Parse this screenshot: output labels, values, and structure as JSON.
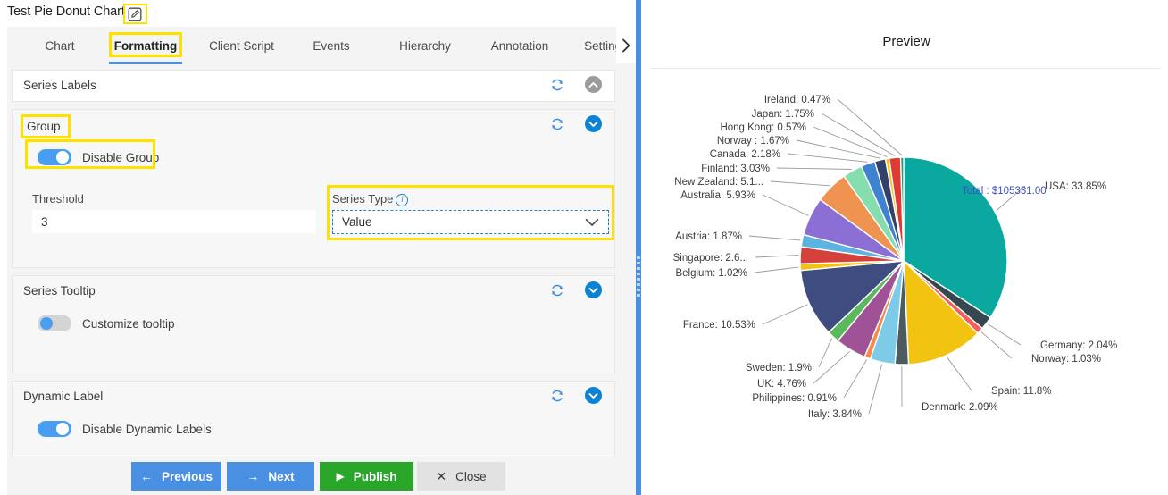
{
  "window": {
    "title": "Test Pie Donut Chart",
    "edit_icon": "pencil-square-icon",
    "help_icon": "?",
    "close_icon": "✕"
  },
  "tabs": {
    "items": [
      {
        "label": "Chart",
        "active": false
      },
      {
        "label": "Formatting",
        "active": true
      },
      {
        "label": "Client Script",
        "active": false
      },
      {
        "label": "Events",
        "active": false
      },
      {
        "label": "Hierarchy",
        "active": false
      },
      {
        "label": "Annotation",
        "active": false
      },
      {
        "label": "Settings",
        "active": false
      }
    ],
    "overflow_icon": "›"
  },
  "panels": {
    "series_labels": {
      "title": "Series Labels",
      "refresh_icon": "refresh-icon",
      "chevron": "chevron-up-icon"
    },
    "group": {
      "title": "Group",
      "refresh_icon": "refresh-icon",
      "chevron": "chevron-down-icon",
      "disable_group_label": "Disable Group",
      "disable_group_state": "on",
      "threshold_label": "Threshold",
      "threshold_value": "3",
      "series_type_label": "Series Type",
      "series_type_info": "i",
      "series_type_value": "Value"
    },
    "series_tooltip": {
      "title": "Series Tooltip",
      "refresh_icon": "refresh-icon",
      "chevron": "chevron-down-icon",
      "customize_tooltip_label": "Customize tooltip",
      "customize_tooltip_state": "off"
    },
    "dynamic_label": {
      "title": "Dynamic Label",
      "refresh_icon": "refresh-icon",
      "chevron": "chevron-down-icon",
      "disable_dynamic_labels_label": "Disable Dynamic Labels",
      "disable_dynamic_labels_state": "on"
    }
  },
  "footer": {
    "previous": "Previous",
    "previous_icon": "←",
    "next": "Next",
    "next_icon": "→",
    "publish": "Publish",
    "publish_icon": "▶",
    "close": "Close",
    "close_icon": "✕"
  },
  "preview": {
    "title": "Preview",
    "center_total_label": "Total : $105331.00"
  },
  "chart_data": {
    "type": "pie",
    "title": "Preview",
    "center_annotation": "Total : $105331.00",
    "total": 105331.0,
    "currency": "$",
    "label_format": "{name}: {percent}%",
    "legend": "none",
    "categories": [
      "USA",
      "Spain",
      "France",
      "Australia",
      "New Zealand",
      "UK",
      "Italy",
      "Finland",
      "Singapore",
      "Canada",
      "Denmark",
      "Germany",
      "Sweden",
      "Austria",
      "Japan",
      "Norway ",
      "Norway",
      "Belgium",
      "Philippines",
      "Hong Kong",
      "Ireland"
    ],
    "values": [
      33.85,
      11.8,
      10.53,
      5.93,
      5.1,
      4.76,
      3.84,
      3.03,
      2.6,
      2.18,
      2.09,
      2.04,
      1.9,
      1.87,
      1.75,
      1.67,
      1.03,
      1.02,
      0.91,
      0.57,
      0.47
    ],
    "unit": "%",
    "slices": [
      {
        "label": "USA: 33.85%",
        "name": "USA",
        "percent": 33.85,
        "color": "#0aa89e"
      },
      {
        "label": "Germany: 2.04%",
        "name": "Germany",
        "percent": 2.04,
        "color": "#37474f"
      },
      {
        "label": "Norway: 1.03%",
        "name": "Norway",
        "percent": 1.03,
        "color": "#f4605a"
      },
      {
        "label": "Spain: 11.8%",
        "name": "Spain",
        "percent": 11.8,
        "color": "#f2c311"
      },
      {
        "label": "Denmark: 2.09%",
        "name": "Denmark",
        "percent": 2.09,
        "color": "#4c5b60"
      },
      {
        "label": "Italy: 3.84%",
        "name": "Italy",
        "percent": 3.84,
        "color": "#7ecbe8"
      },
      {
        "label": "Philippines: 0.91%",
        "name": "Philippines",
        "percent": 0.91,
        "color": "#f58a4b"
      },
      {
        "label": "UK: 4.76%",
        "name": "UK",
        "percent": 4.76,
        "color": "#a05296"
      },
      {
        "label": "Sweden: 1.9%",
        "name": "Sweden",
        "percent": 1.9,
        "color": "#5cb85c"
      },
      {
        "label": "France: 10.53%",
        "name": "France",
        "percent": 10.53,
        "color": "#3e4c80"
      },
      {
        "label": "Belgium: 1.02%",
        "name": "Belgium",
        "percent": 1.02,
        "color": "#f2c311"
      },
      {
        "label": "Singapore: 2.6...",
        "name": "Singapore",
        "percent": 2.6,
        "color": "#d6403a"
      },
      {
        "label": "Austria: 1.87%",
        "name": "Austria",
        "percent": 1.87,
        "color": "#5cb3e0"
      },
      {
        "label": "Australia: 5.93%",
        "name": "Australia",
        "percent": 5.93,
        "color": "#8b6fd4"
      },
      {
        "label": "New Zealand: 5.1...",
        "name": "New Zealand",
        "percent": 5.1,
        "color": "#ef9350"
      },
      {
        "label": "Finland: 3.03%",
        "name": "Finland",
        "percent": 3.03,
        "color": "#86ddae"
      },
      {
        "label": "Canada: 2.18%",
        "name": "Canada",
        "percent": 2.18,
        "color": "#3f82d0"
      },
      {
        "label": "Norway : 1.67%",
        "name": "Norway ",
        "percent": 1.67,
        "color": "#33406b"
      },
      {
        "label": "Hong Kong: 0.57%",
        "name": "Hong Kong",
        "percent": 0.57,
        "color": "#f2c311"
      },
      {
        "label": "Japan: 1.75%",
        "name": "Japan",
        "percent": 1.75,
        "color": "#e03a34"
      },
      {
        "label": "Ireland: 0.47%",
        "name": "Ireland",
        "percent": 0.47,
        "color": "#1f9e7a"
      }
    ]
  }
}
